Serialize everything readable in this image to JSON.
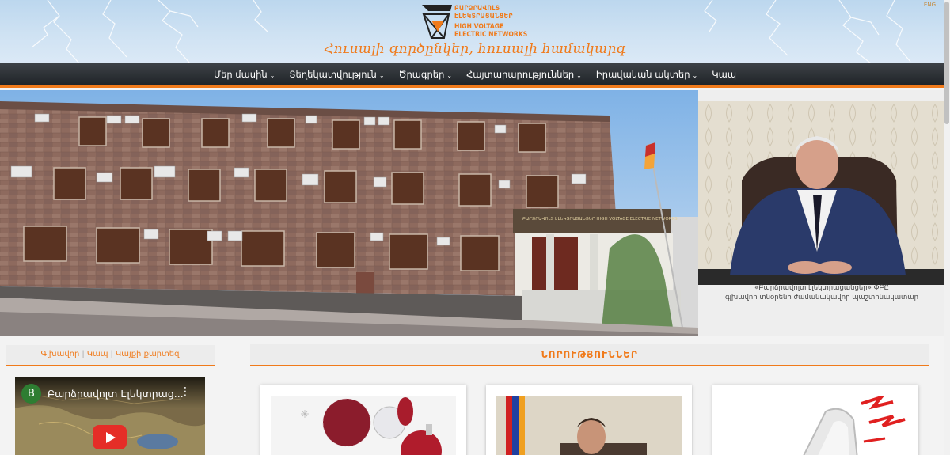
{
  "header": {
    "logo_armenian": [
      "ԲԱՐՁՐԱՎՈԼՏ",
      "ԷԼԵԿՏՐԱՑԱՆՑԵՐ"
    ],
    "logo_english": [
      "HIGH VOLTAGE",
      "ELECTRIC NETWORKS"
    ],
    "slogan": "Հուսալի գործընկեր, հուսալի համակարգ",
    "lang": "ENG"
  },
  "nav": {
    "items": [
      {
        "label": "Մեր մասին",
        "has_dropdown": true
      },
      {
        "label": "Տեղեկատվություն",
        "has_dropdown": true
      },
      {
        "label": "Ծրագրեր",
        "has_dropdown": true
      },
      {
        "label": "Հայտարարություններ",
        "has_dropdown": true
      },
      {
        "label": "Իրավական ակտեր",
        "has_dropdown": true
      },
      {
        "label": "Կապ",
        "has_dropdown": false
      }
    ]
  },
  "hero": {
    "sign_text": "ԲԱՐՁՐԱՎՈԼՏ ԷԼԵԿՏՐԱՑԱՆՑԵՐ   HIGH VOLTAGE ELECTRIC NETWORKS",
    "caption_line1": "«Բարձրավոլտ էլեկտրացանցեր» ՓԲԸ",
    "caption_line2": "գլխավոր տնօրենի ժամանակավոր պաշտոնակատար"
  },
  "sidebar": {
    "links": [
      "Գլխավոր",
      "Կապ",
      "Կայքի քարտեզ"
    ],
    "video": {
      "avatar_letter": "B",
      "title": "Բարձրավոլտ Էլեկտրաց..."
    }
  },
  "news": {
    "heading": "ՆՈՐՈՒԹՅՈՒՆՆԵՐ"
  },
  "colors": {
    "accent": "#f07a1a",
    "nav_bg": "#2a2e33",
    "youtube_red": "#e52d27"
  }
}
